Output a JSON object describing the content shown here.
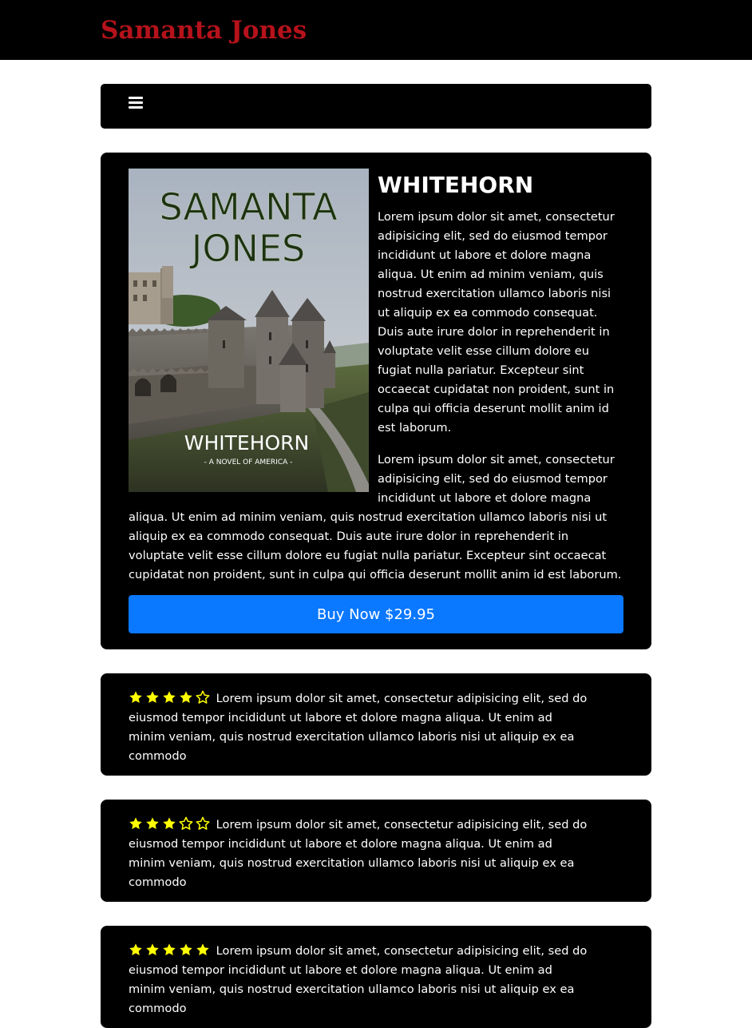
{
  "header": {
    "site_title": "Samanta Jones"
  },
  "nav": {
    "menu_icon": "hamburger-menu-icon"
  },
  "book": {
    "cover": {
      "author_text": "SAMANTA JONES",
      "title_text": "WHITEHORN",
      "subtitle_text": "- A NOVEL OF AMERICA -"
    },
    "title": "WHITEHORN",
    "paragraphs": [
      "Lorem ipsum dolor sit amet, consectetur adipisicing elit, sed do eiusmod tempor incididunt ut labore et dolore magna aliqua. Ut enim ad minim veniam, quis nostrud exercitation ullamco laboris nisi ut aliquip ex ea commodo consequat. Duis aute irure dolor in reprehenderit in voluptate velit esse cillum dolore eu fugiat nulla pariatur. Excepteur sint occaecat cupidatat non proident, sunt in culpa qui officia deserunt mollit anim id est laborum.",
      "Lorem ipsum dolor sit amet, consectetur adipisicing elit, sed do eiusmod tempor incididunt ut labore et dolore magna aliqua. Ut enim ad minim veniam, quis nostrud exercitation ullamco laboris nisi ut aliquip ex ea commodo consequat. Duis aute irure dolor in reprehenderit in voluptate velit esse cillum dolore eu fugiat nulla pariatur. Excepteur sint occaecat cupidatat non proident, sunt in culpa qui officia deserunt mollit anim id est laborum."
    ],
    "buy_button_label": "Buy Now $29.95"
  },
  "reviews": [
    {
      "rating": 4,
      "max_rating": 5,
      "text": "Lorem ipsum dolor sit amet, consectetur adipisicing elit, sed do eiusmod tempor incididunt ut labore et dolore magna aliqua. Ut enim ad minim veniam, quis nostrud exercitation ullamco laboris nisi ut aliquip ex ea commodo"
    },
    {
      "rating": 3,
      "max_rating": 5,
      "text": "Lorem ipsum dolor sit amet, consectetur adipisicing elit, sed do eiusmod tempor incididunt ut labore et dolore magna aliqua. Ut enim ad minim veniam, quis nostrud exercitation ullamco laboris nisi ut aliquip ex ea commodo"
    },
    {
      "rating": 5,
      "max_rating": 5,
      "text": "Lorem ipsum dolor sit amet, consectetur adipisicing elit, sed do eiusmod tempor incididunt ut labore et dolore magna aliqua. Ut enim ad minim veniam, quis nostrud exercitation ullamco laboris nisi ut aliquip ex ea commodo"
    }
  ],
  "colors": {
    "site_title": "#b5121b",
    "star_filled": "#ffff00",
    "buy_button": "#0a78ff",
    "card_background": "#000000"
  },
  "icons": {
    "star_filled": "star-filled-icon",
    "star_empty": "star-empty-icon"
  }
}
